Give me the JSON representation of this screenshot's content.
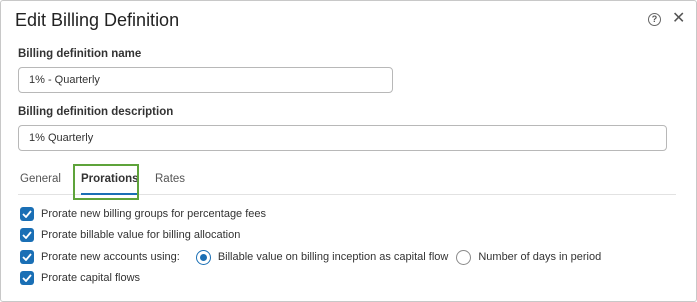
{
  "dialog": {
    "title": "Edit Billing Definition",
    "help_icon": "question-circle-icon",
    "close_icon": "close-icon"
  },
  "fields": {
    "name_label": "Billing definition name",
    "name_value": "1% - Quarterly",
    "description_label": "Billing definition description",
    "description_value": "1% Quarterly"
  },
  "tabs": [
    {
      "label": "General",
      "active": false
    },
    {
      "label": "Prorations",
      "active": true
    },
    {
      "label": "Rates",
      "active": false
    }
  ],
  "options": [
    {
      "label": "Prorate new billing groups for percentage fees",
      "checked": true
    },
    {
      "label": "Prorate billable value for billing allocation",
      "checked": true
    },
    {
      "label": "Prorate new accounts using:",
      "checked": true
    },
    {
      "label": "Prorate capital flows",
      "checked": true
    }
  ],
  "proration_method": {
    "options": [
      {
        "label": "Billable value on billing inception as capital flow",
        "selected": true
      },
      {
        "label": "Number of days in period",
        "selected": false
      }
    ]
  },
  "colors": {
    "accent": "#1a6fb5",
    "highlight": "#5ea33a"
  }
}
